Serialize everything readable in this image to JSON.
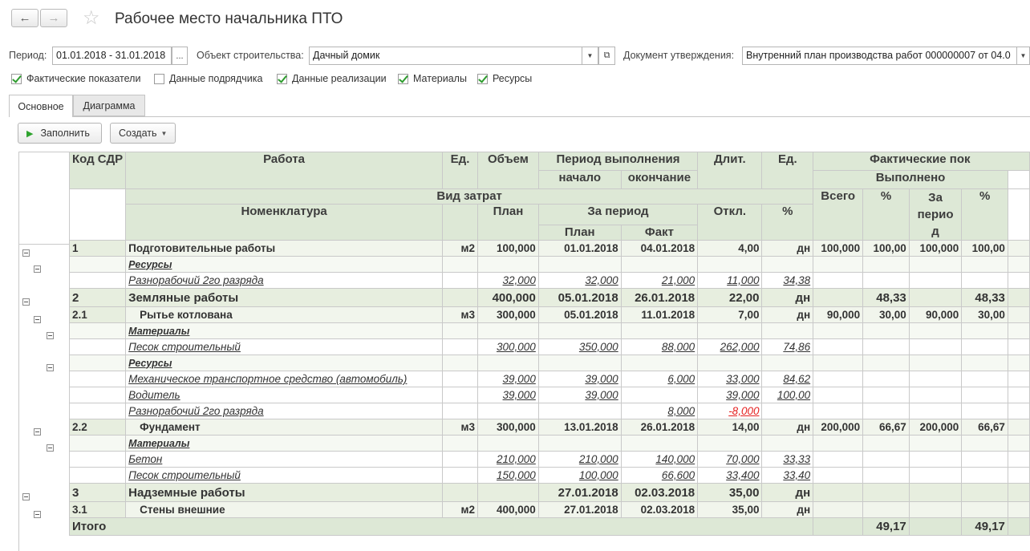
{
  "window": {
    "title": "Рабочее место начальника ПТО"
  },
  "filters": {
    "period_label": "Период:",
    "period_value": "01.01.2018 - 31.01.2018",
    "period_btn": "...",
    "object_label": "Объект строительства:",
    "object_value": "Дачный домик",
    "doc_label": "Документ утверждения:",
    "doc_value": "Внутренний план производства работ 000000007 от 04.0"
  },
  "checkboxes": [
    {
      "label": "Фактические показатели",
      "checked": true
    },
    {
      "label": "Данные подрядчика",
      "checked": false
    },
    {
      "label": "Данные реализации",
      "checked": true
    },
    {
      "label": "Материалы",
      "checked": true
    },
    {
      "label": "Ресурсы",
      "checked": true
    }
  ],
  "tabs": [
    "Основное",
    "Диаграмма"
  ],
  "toolbar": {
    "fill": "Заполнить",
    "create": "Создать"
  },
  "headers": {
    "code": "Код СДР",
    "work": "Работа",
    "unit": "Ед.",
    "volume": "Объем",
    "period": "Период выполнения",
    "start": "начало",
    "end": "окончание",
    "duration": "Длит.",
    "unit2": "Ед.",
    "actual": "Фактические пок",
    "done": "Выполнено",
    "cost_type": "Вид затрат",
    "nomenclature": "Номенклатура",
    "plan": "План",
    "for_period": "За период",
    "plan2": "План",
    "fact": "Факт",
    "deviation": "Откл.",
    "percent": "%",
    "total": "Всего",
    "pct1": "%",
    "for_period2": "За перио д",
    "pct2": "%"
  },
  "rows": [
    {
      "type": "lvl2",
      "code": "1",
      "work": "Подготовительные работы",
      "unit": "м2",
      "volume": "100,000",
      "start": "01.01.2018",
      "end": "04.01.2018",
      "dur": "4,00",
      "dur_unit": "дн",
      "total": "100,000",
      "pct": "100,00",
      "period": "100,000",
      "pct2": "100,00"
    },
    {
      "type": "grp",
      "work": "Ресурсы"
    },
    {
      "type": "item",
      "work": "Разнорабочий 2го разряда",
      "volume": "32,000",
      "start": "32,000",
      "end": "21,000",
      "dur": "11,000",
      "dur_unit": "34,38"
    },
    {
      "type": "lvl1",
      "code": "2",
      "work": "Земляные работы",
      "volume": "400,000",
      "start": "05.01.2018",
      "end": "26.01.2018",
      "dur": "22,00",
      "dur_unit": "дн",
      "pct": "48,33",
      "pct2": "48,33"
    },
    {
      "type": "lvl2",
      "code": "2.1",
      "work": "Рытье котлована",
      "unit": "м3",
      "volume": "300,000",
      "start": "05.01.2018",
      "end": "11.01.2018",
      "dur": "7,00",
      "dur_unit": "дн",
      "total": "90,000",
      "pct": "30,00",
      "period": "90,000",
      "pct2": "30,00"
    },
    {
      "type": "grp",
      "work": "Материалы"
    },
    {
      "type": "item",
      "work": "Песок строительный",
      "volume": "300,000",
      "start": "350,000",
      "end": "88,000",
      "dur": "262,000",
      "dur_unit": "74,86"
    },
    {
      "type": "grp",
      "work": "Ресурсы"
    },
    {
      "type": "item",
      "work": "Механическое транспортное средство (автомобиль)",
      "volume": "39,000",
      "start": "39,000",
      "end": "6,000",
      "dur": "33,000",
      "dur_unit": "84,62"
    },
    {
      "type": "item",
      "work": "Водитель",
      "volume": "39,000",
      "start": "39,000",
      "dur": "39,000",
      "dur_unit": "100,00"
    },
    {
      "type": "item",
      "work": "Разнорабочий 2го разряда",
      "end": "8,000",
      "dur": "-8,000",
      "neg": true
    },
    {
      "type": "lvl2",
      "code": "2.2",
      "work": "Фундамент",
      "unit": "м3",
      "volume": "300,000",
      "start": "13.01.2018",
      "end": "26.01.2018",
      "dur": "14,00",
      "dur_unit": "дн",
      "total": "200,000",
      "pct": "66,67",
      "period": "200,000",
      "pct2": "66,67"
    },
    {
      "type": "grp",
      "work": "Материалы"
    },
    {
      "type": "item",
      "work": "Бетон",
      "volume": "210,000",
      "start": "210,000",
      "end": "140,000",
      "dur": "70,000",
      "dur_unit": "33,33"
    },
    {
      "type": "item",
      "work": "Песок строительный",
      "volume": "150,000",
      "start": "100,000",
      "end": "66,600",
      "dur": "33,400",
      "dur_unit": "33,40"
    },
    {
      "type": "lvl1",
      "code": "3",
      "work": "Надземные работы",
      "start": "27.01.2018",
      "end": "02.03.2018",
      "dur": "35,00",
      "dur_unit": "дн"
    },
    {
      "type": "lvl2",
      "code": "3.1",
      "work": "Стены внешние",
      "unit": "м2",
      "volume": "400,000",
      "start": "27.01.2018",
      "end": "02.03.2018",
      "dur": "35,00",
      "dur_unit": "дн"
    }
  ],
  "totals": {
    "label": "Итого",
    "pct": "49,17",
    "pct2": "49,17"
  }
}
